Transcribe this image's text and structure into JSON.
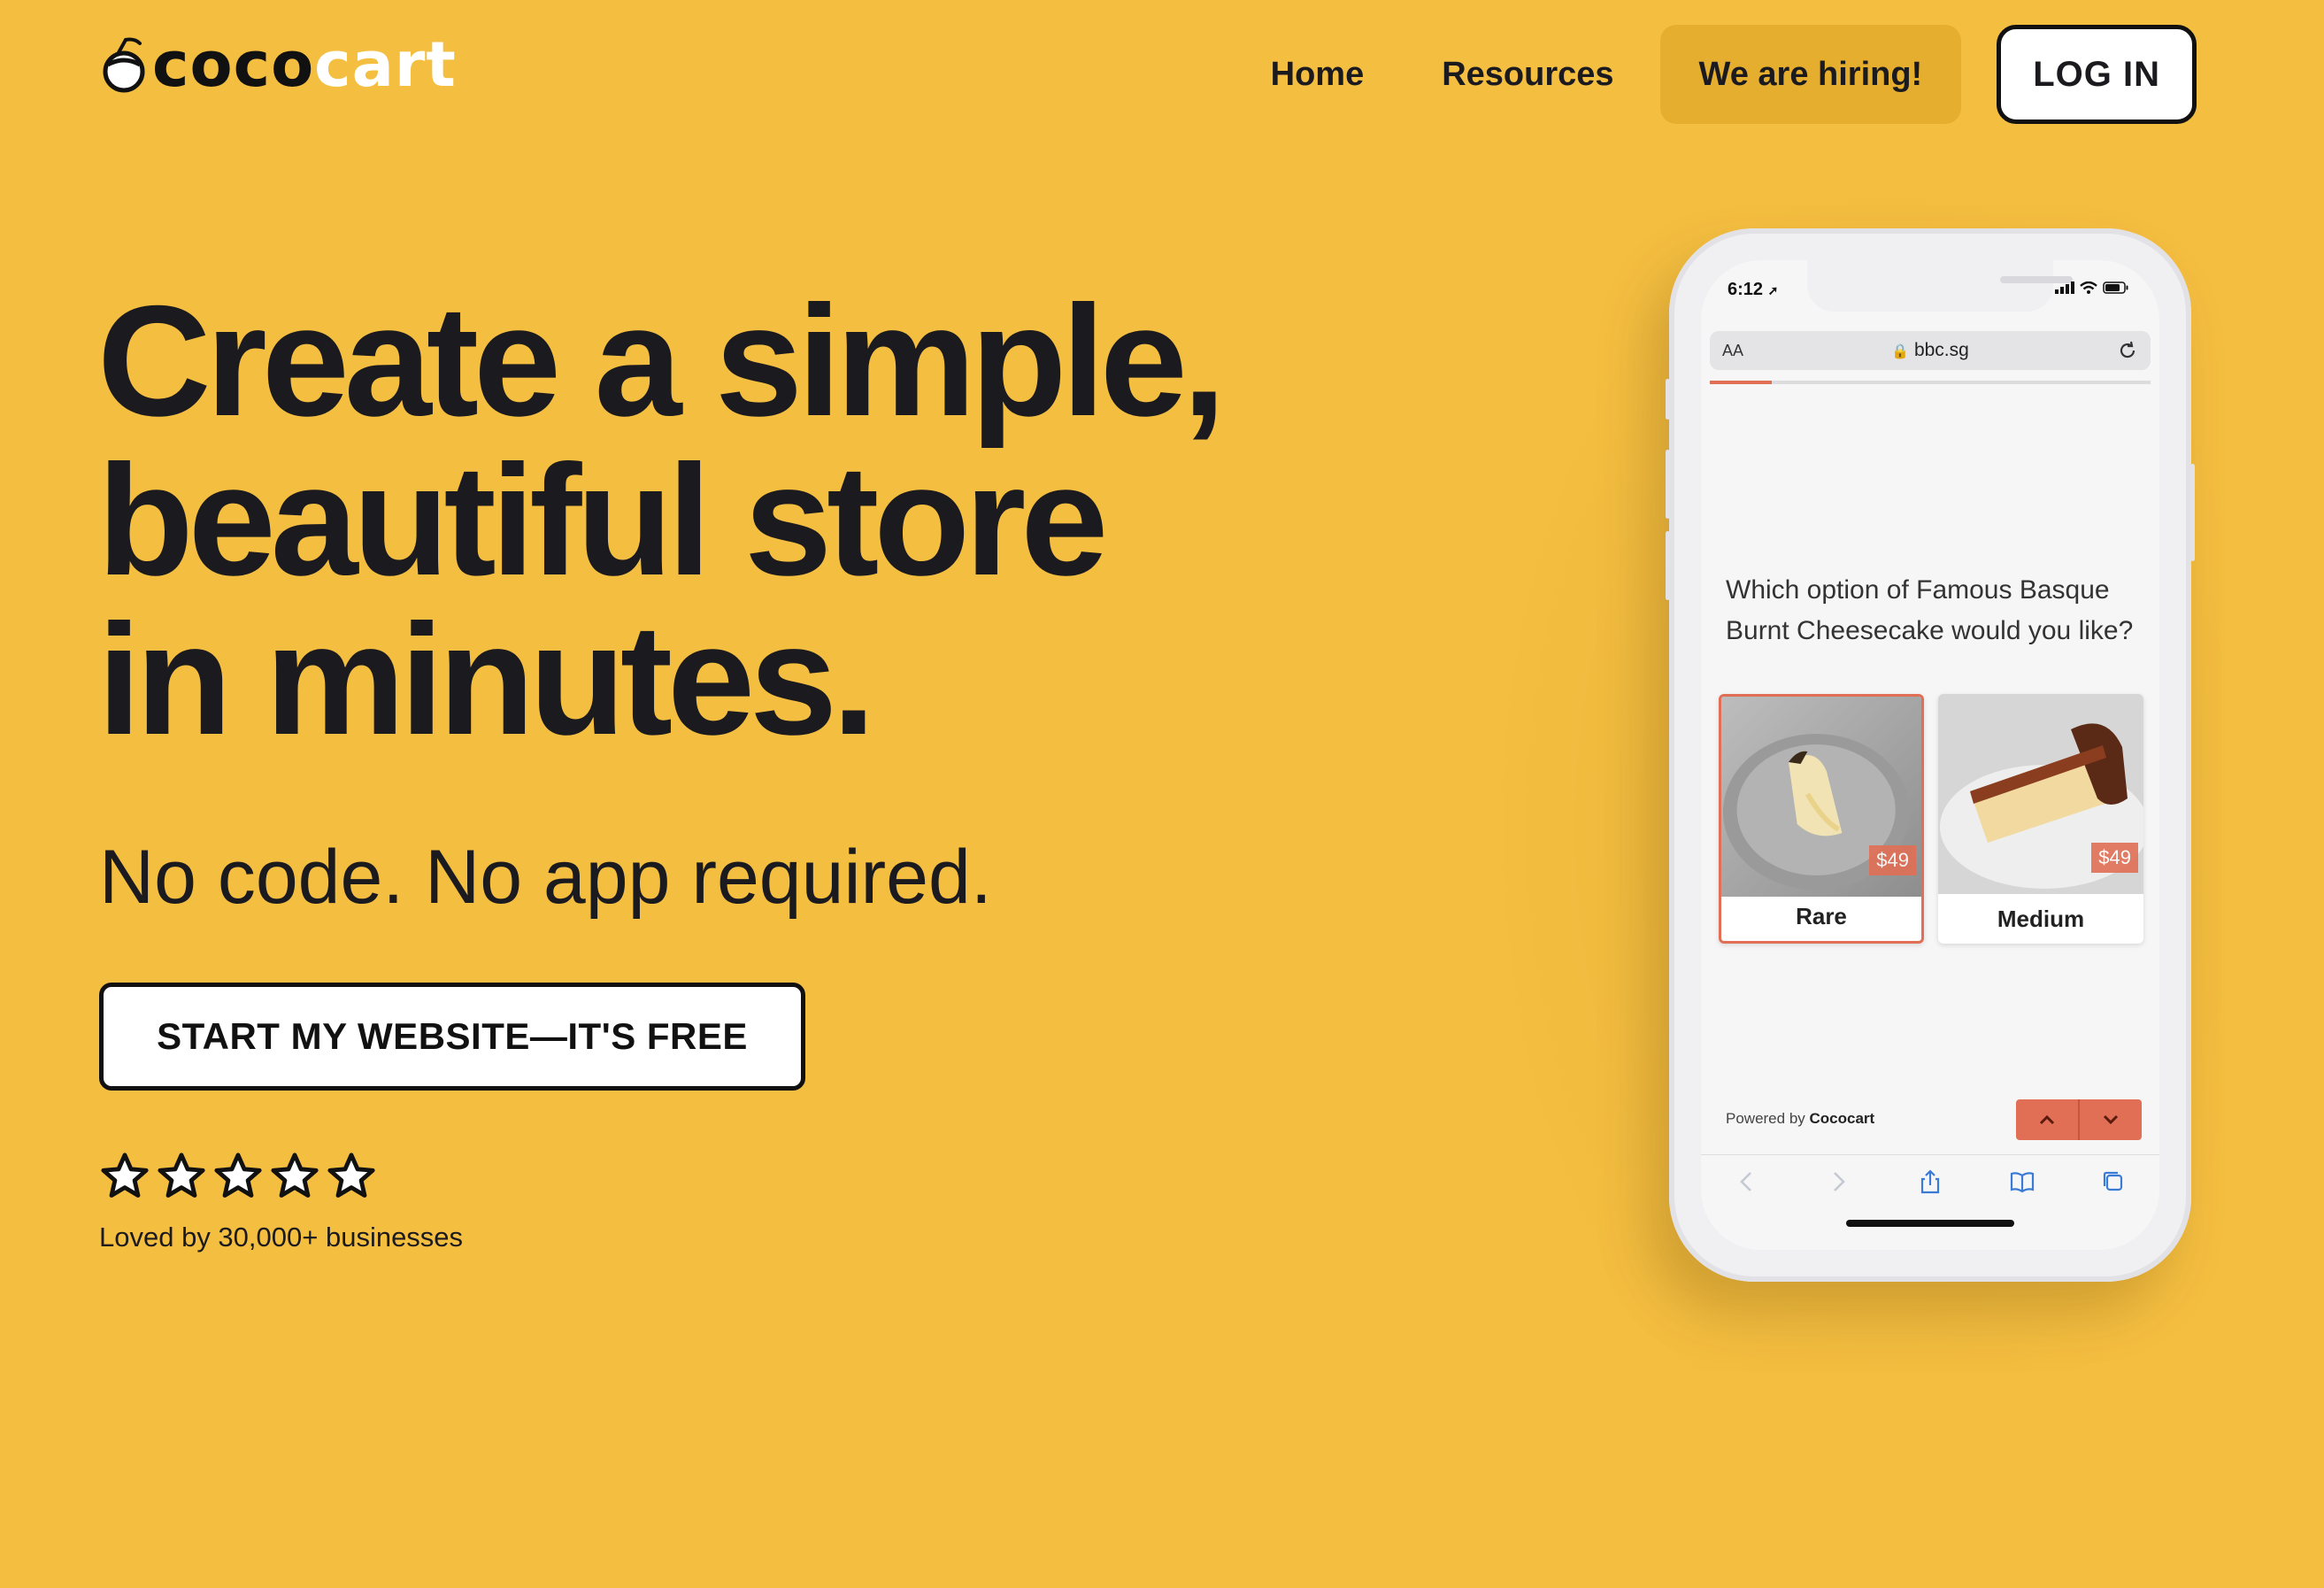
{
  "logo": {
    "part1": "coco",
    "part2": "cart"
  },
  "nav": {
    "home": "Home",
    "resources": "Resources",
    "hiring": "We are hiring!",
    "login": "LOG IN"
  },
  "hero": {
    "headline_line1": "Create a simple,",
    "headline_line2": "beautiful store",
    "headline_line3": "in minutes.",
    "subhead": "No code. No app required.",
    "cta": "START MY WEBSITE—IT'S FREE",
    "rating_stars": 5,
    "loved_by": "Loved by 30,000+ businesses"
  },
  "phone": {
    "status_time": "6:12",
    "url_aa": "AA",
    "url": "bbc.sg",
    "progress": 0.14,
    "question": "Which option of Famous Basque Burnt Cheesecake would you like?",
    "options": [
      {
        "label": "Rare",
        "price": "$49",
        "selected": true
      },
      {
        "label": "Medium",
        "price": "$49",
        "selected": false
      }
    ],
    "powered_prefix": "Powered by",
    "powered_brand": "Cococart"
  },
  "colors": {
    "background": "#F4BE40",
    "hiring_bg": "#E5AE2E",
    "accent": "#E06F55",
    "text": "#1b1b1f"
  }
}
